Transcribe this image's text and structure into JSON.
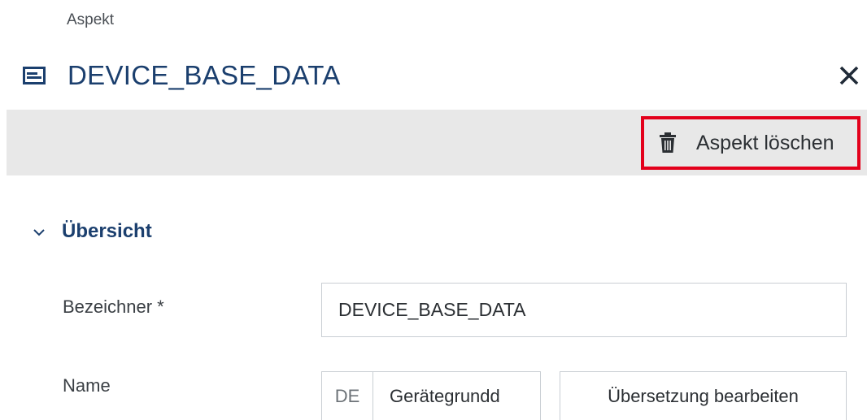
{
  "breadcrumb": "Aspekt",
  "header": {
    "title": "DEVICE_BASE_DATA",
    "title_icon": "aspect-card-icon",
    "close_icon": "close-icon"
  },
  "toolbar": {
    "delete_label": "Aspekt löschen",
    "delete_icon": "trash-icon",
    "highlight_color": "#e3001b"
  },
  "section": {
    "label": "Übersicht",
    "expanded": true
  },
  "fields": {
    "bezeichner": {
      "label": "Bezeichner *",
      "value": "DEVICE_BASE_DATA"
    },
    "name": {
      "label": "Name",
      "lang": "DE",
      "value": "Gerätegrundd",
      "translate_label": "Übersetzung bearbeiten"
    }
  },
  "colors": {
    "title": "#1b3f6e",
    "toolbar_bg": "#e8e8e8"
  }
}
